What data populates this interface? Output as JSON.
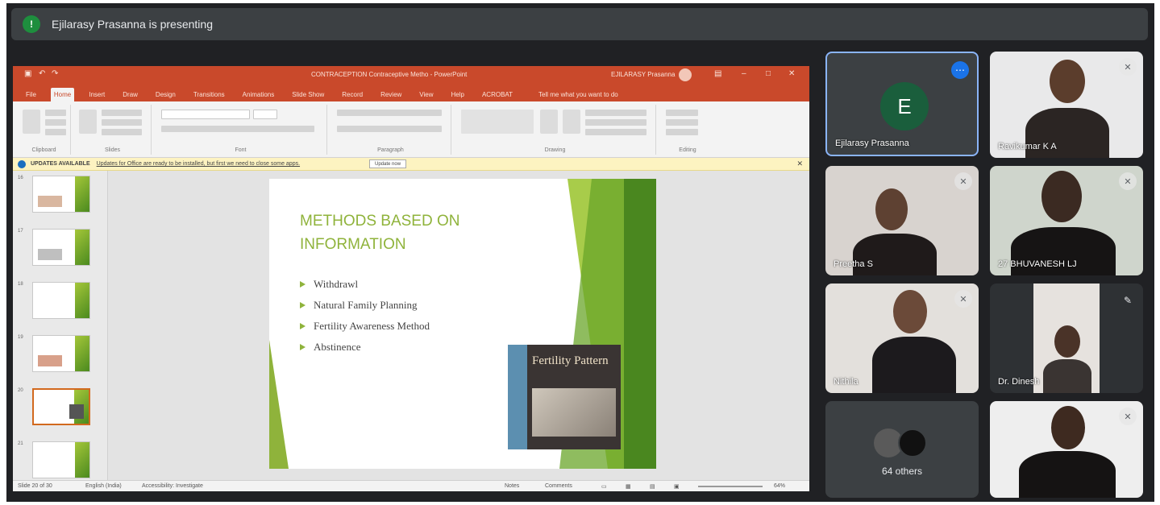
{
  "presenting_bar": {
    "badge": "!",
    "text": "Ejilarasy Prasanna is presenting"
  },
  "powerpoint": {
    "document_title": "CONTRACEPTION Contraceptive Metho - PowerPoint",
    "user_name": "EJILARASY Prasanna",
    "tabs": [
      "File",
      "Home",
      "Insert",
      "Draw",
      "Design",
      "Transitions",
      "Animations",
      "Slide Show",
      "Record",
      "Review",
      "View",
      "Help",
      "ACROBAT"
    ],
    "active_tab": "Home",
    "tell_me": "Tell me what you want to do",
    "ribbon_groups": [
      "Clipboard",
      "Slides",
      "Font",
      "Paragraph",
      "Drawing",
      "Editing"
    ],
    "message_bar": {
      "title": "UPDATES AVAILABLE",
      "body": "Updates for Office are ready to be installed, but first we need to close some apps.",
      "button": "Update now"
    },
    "thumbnail_numbers": [
      "16",
      "17",
      "18",
      "19",
      "20",
      "21"
    ],
    "slide": {
      "title": "METHODS BASED ON INFORMATION",
      "bullets": [
        "Withdrawl",
        "Natural Family Planning",
        "Fertility Awareness Method",
        "Abstinence"
      ],
      "book_title": "Fertility Pattern"
    },
    "status_bar": {
      "slide_of": "Slide 20 of 30",
      "language": "English (India)",
      "accessibility": "Accessibility: Investigate",
      "notes": "Notes",
      "comments": "Comments",
      "zoom": "64%"
    }
  },
  "participants": {
    "main_tile": {
      "avatar_letter": "E",
      "name": "Ejilarasy Prasanna",
      "more_icon": "more-options-icon"
    },
    "tiles": [
      {
        "name": "Ravikumar K A"
      },
      {
        "name": "Preetha S"
      },
      {
        "name": "27 BHUVANESH LJ"
      },
      {
        "name": "Nithila"
      },
      {
        "name": "Dr. Dinesh"
      }
    ],
    "others": {
      "text": "64 others"
    }
  },
  "colors": {
    "meet_bg": "#202124",
    "tile_bg": "#3c4043",
    "ppt_accent": "#c9492b",
    "slide_green": "#8fb33b",
    "highlight_blue": "#8ab4f8"
  }
}
